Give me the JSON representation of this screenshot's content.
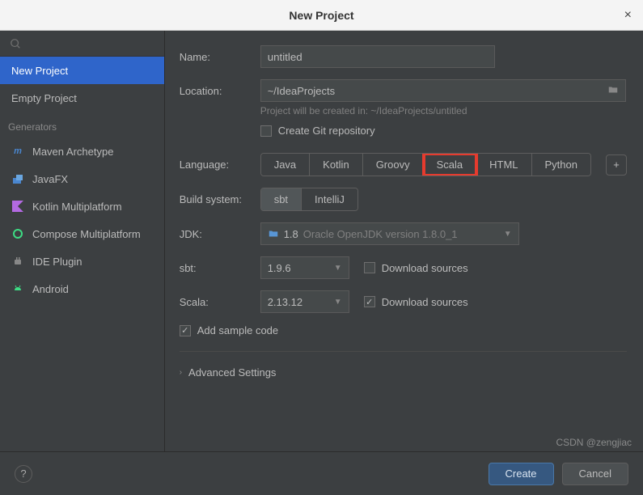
{
  "titlebar": {
    "title": "New Project"
  },
  "sidebar": {
    "items": [
      {
        "label": "New Project"
      },
      {
        "label": "Empty Project"
      }
    ],
    "generators_header": "Generators",
    "generators": [
      {
        "label": "Maven Archetype",
        "icon_text": "m",
        "icon_color": "#4a86cf"
      },
      {
        "label": "JavaFX",
        "icon_text": "",
        "icon_color": "#4a86cf"
      },
      {
        "label": "Kotlin Multiplatform",
        "icon_text": "",
        "icon_color": "#b36ae2"
      },
      {
        "label": "Compose Multiplatform",
        "icon_text": "",
        "icon_color": "#3ddc84"
      },
      {
        "label": "IDE Plugin",
        "icon_text": "",
        "icon_color": "#888"
      },
      {
        "label": "Android",
        "icon_text": "",
        "icon_color": "#3ddc84"
      }
    ]
  },
  "form": {
    "name_label": "Name:",
    "name_value": "untitled",
    "location_label": "Location:",
    "location_value": "~/IdeaProjects",
    "location_hint": "Project will be created in: ~/IdeaProjects/untitled",
    "git_checkbox": "Create Git repository",
    "language_label": "Language:",
    "languages": [
      "Java",
      "Kotlin",
      "Groovy",
      "Scala",
      "HTML",
      "Python"
    ],
    "language_selected": "Scala",
    "build_label": "Build system:",
    "build_options": [
      "sbt",
      "IntelliJ"
    ],
    "build_selected": "sbt",
    "jdk_label": "JDK:",
    "jdk_value": "1.8",
    "jdk_detail": "Oracle OpenJDK version 1.8.0_1",
    "sbt_label": "sbt:",
    "sbt_value": "1.9.6",
    "sbt_download": "Download sources",
    "scala_label": "Scala:",
    "scala_value": "2.13.12",
    "scala_download": "Download sources",
    "add_sample": "Add sample code",
    "advanced": "Advanced Settings"
  },
  "footer": {
    "create": "Create",
    "cancel": "Cancel"
  },
  "watermark": "CSDN @zengjiac"
}
